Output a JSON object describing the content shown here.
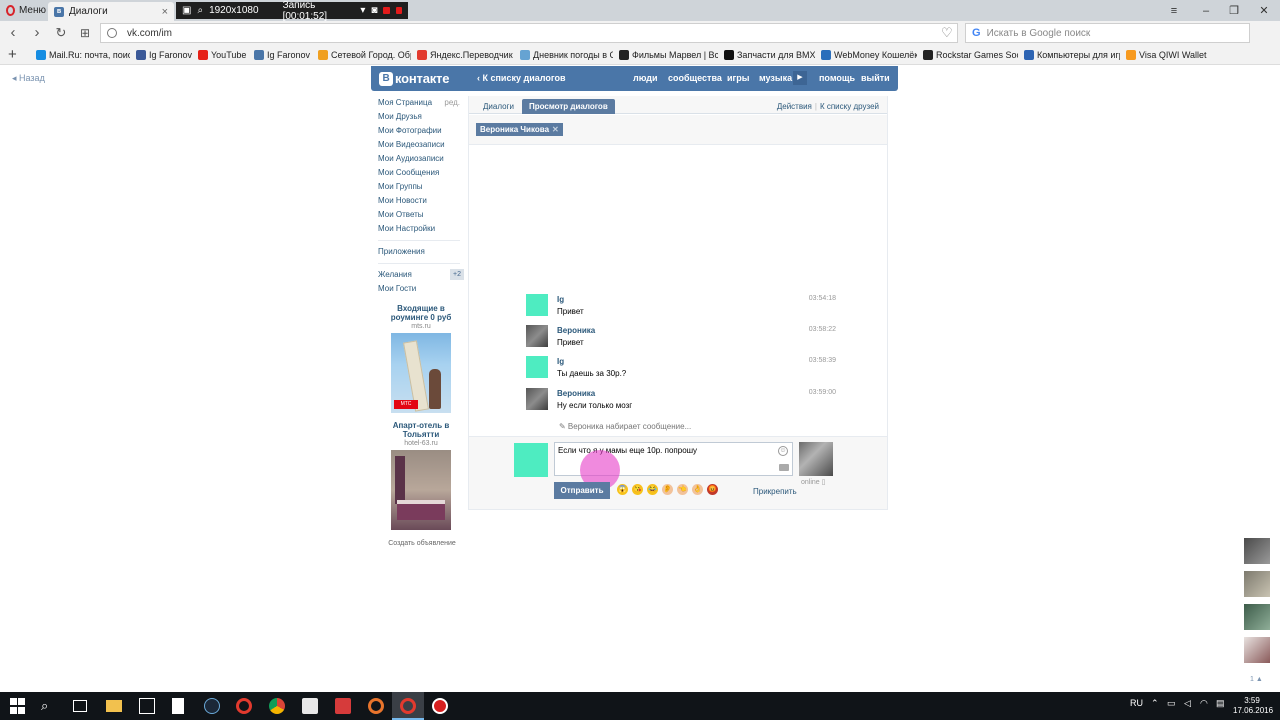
{
  "browser": {
    "menu_label": "Меню",
    "tab_title": "Диалоги",
    "recorder": {
      "resolution": "1920x1080",
      "status": "Запись [00:01:52]"
    },
    "url": "vk.com/im",
    "search_placeholder": "Искать в Google поиск",
    "bookmarks": [
      {
        "label": "Mail.Ru: почта, поиск",
        "color": "#168de2"
      },
      {
        "label": "Ig Faronov",
        "color": "#3b5998"
      },
      {
        "label": "YouTube",
        "color": "#e62117"
      },
      {
        "label": "Ig Faronov",
        "color": "#4a76a8"
      },
      {
        "label": "Сетевой Город. Образ",
        "color": "#f0a020"
      },
      {
        "label": "Яндекс.Переводчик",
        "color": "#e23a2e"
      },
      {
        "label": "Дневник погоды в С",
        "color": "#66a3d2"
      },
      {
        "label": "Фильмы Марвел | Вс",
        "color": "#222222"
      },
      {
        "label": "Запчасти для BMX В",
        "color": "#111111"
      },
      {
        "label": "WebMoney Кошелёк",
        "color": "#2a6ebb"
      },
      {
        "label": "Rockstar Games Socia",
        "color": "#222222"
      },
      {
        "label": "Компьютеры для игр",
        "color": "#2d64b3"
      },
      {
        "label": "Visa QIWI Wallet",
        "color": "#f79a1f"
      }
    ]
  },
  "page": {
    "back_label": "Назад"
  },
  "vk_header": {
    "logo_badge": "В",
    "logo_text": "контакте",
    "back_to_dialogs": "‹ К списку диалогов",
    "nav": [
      "люди",
      "сообщества",
      "игры",
      "музыка",
      "помощь",
      "выйти"
    ]
  },
  "left_menu": {
    "edit_label": "ред.",
    "items_top": [
      "Моя Страница",
      "Мои Друзья",
      "Мои Фотографии",
      "Мои Видеозаписи",
      "Мои Аудиозаписи",
      "Мои Сообщения",
      "Мои Группы",
      "Мои Новости",
      "Мои Ответы",
      "Мои Настройки"
    ],
    "apps": "Приложения",
    "wishes": "Желания",
    "wishes_badge": "+2",
    "guests": "Мои Гости",
    "ads": [
      {
        "title": "Входящие в роуминге 0 руб",
        "domain": "mts.ru",
        "badge": "МТС"
      },
      {
        "title": "Апарт-отель в Тольятти",
        "domain": "hotel-63.ru"
      }
    ],
    "create_ad": "Создать объявление"
  },
  "im": {
    "tabs": [
      "Диалоги",
      "Просмотр диалогов"
    ],
    "actions": [
      "Действия",
      "К списку друзей"
    ],
    "peer_chip": "Вероника Чикова",
    "messages": [
      {
        "author": "Ig",
        "text": "Привет",
        "time": "03:54:18",
        "avatar": "green"
      },
      {
        "author": "Вероника",
        "text": "Привет",
        "time": "03:58:22",
        "avatar": "photo"
      },
      {
        "author": "Ig",
        "text": "Ты даешь за 30р.?",
        "time": "03:58:39",
        "avatar": "green"
      },
      {
        "author": "Вероника",
        "text": "Ну если только мозг",
        "time": "03:59:00",
        "avatar": "photo"
      }
    ],
    "typing": "✎ Вероника набирает сообщение...",
    "compose_text": "Если что я у мамы еще 10р. попрошу",
    "send_label": "Отправить",
    "attach_label": "Прикрепить",
    "online_label": "online ▯",
    "emojis": [
      {
        "glyph": "😱",
        "color": "#f7c21b"
      },
      {
        "glyph": "😘",
        "color": "#f7c21b"
      },
      {
        "glyph": "😂",
        "color": "#f7c21b"
      },
      {
        "glyph": "👂",
        "color": "#f2c29a"
      },
      {
        "glyph": "👈",
        "color": "#f2c29a"
      },
      {
        "glyph": "👌",
        "color": "#f2c29a"
      },
      {
        "glyph": "😡",
        "color": "#c0392b"
      }
    ]
  },
  "side_panel": {
    "count": "1 ▲"
  },
  "taskbar": {
    "lang": "RU",
    "time": "3:59",
    "date": "17.06.2016"
  }
}
